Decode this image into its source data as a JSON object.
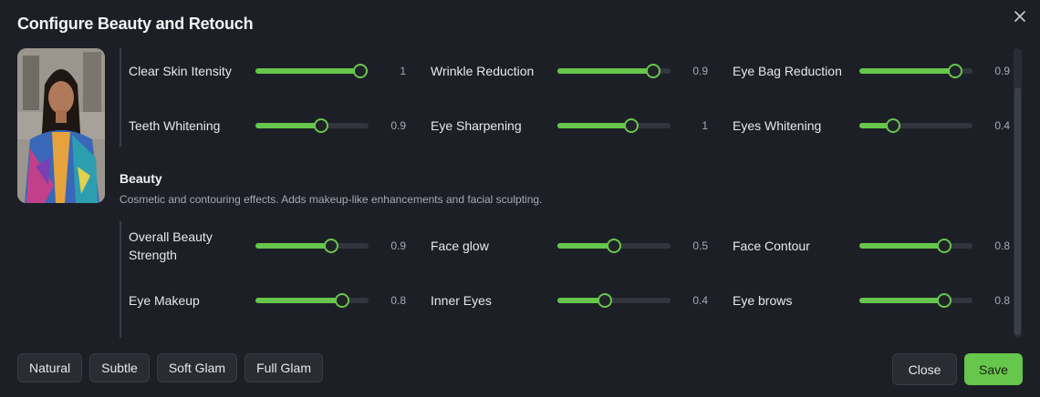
{
  "dialog": {
    "title": "Configure Beauty and Retouch",
    "close_icon": "close-icon"
  },
  "photo": {
    "icon": "portrait-photo"
  },
  "retouch": {
    "controls": [
      {
        "label": "Clear Skin Itensity",
        "value": "1",
        "level": 0.93
      },
      {
        "label": "Wrinkle Reduction",
        "value": "0.9",
        "level": 0.85
      },
      {
        "label": "Eye Bag Reduction",
        "value": "0.9",
        "level": 0.85
      },
      {
        "label": "Teeth Whitening",
        "value": "0.9",
        "level": 0.58
      },
      {
        "label": "Eye Sharpening",
        "value": "1",
        "level": 0.65
      },
      {
        "label": "Eyes Whitening",
        "value": "0.4",
        "level": 0.3
      }
    ]
  },
  "beauty": {
    "title": "Beauty",
    "description": "Cosmetic and contouring effects. Adds makeup-like enhancements and facial sculpting.",
    "controls": [
      {
        "label": "Overall Beauty Strength",
        "value": "0.9",
        "level": 0.67
      },
      {
        "label": "Face glow",
        "value": "0.5",
        "level": 0.5
      },
      {
        "label": "Face Contour",
        "value": "0.8",
        "level": 0.75
      },
      {
        "label": "Eye Makeup",
        "value": "0.8",
        "level": 0.77
      },
      {
        "label": "Inner Eyes",
        "value": "0.4",
        "level": 0.42
      },
      {
        "label": "Eye brows",
        "value": "0.8",
        "level": 0.75
      }
    ]
  },
  "presets": [
    "Natural",
    "Subtle",
    "Soft Glam",
    "Full Glam"
  ],
  "footer": {
    "close_label": "Close",
    "save_label": "Save"
  },
  "colors": {
    "accent": "#67c64c",
    "background": "#1d1f26",
    "track": "#32353d"
  }
}
